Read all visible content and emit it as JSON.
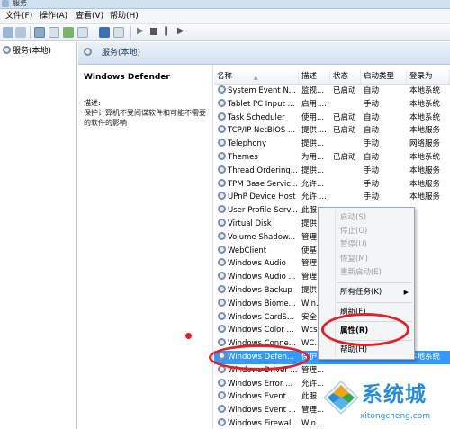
{
  "window": {
    "title": "服务"
  },
  "menu": [
    "文件(F)",
    "操作(A)",
    "查看(V)",
    "帮助(H)"
  ],
  "tree": {
    "root_label": "服务(本地)"
  },
  "header": {
    "title": "服务(本地)"
  },
  "details": {
    "service_name": "Windows Defender",
    "desc_label": "描述:",
    "desc_text": "保护计算机不受间谍软件和可能不需要的软件的影响"
  },
  "columns": [
    "名称",
    "描述",
    "状态",
    "启动类型",
    "登录为"
  ],
  "rows": [
    {
      "name": "System Event N...",
      "desc": "监视...",
      "status": "已启动",
      "start": "自动",
      "logon": "本地系统"
    },
    {
      "name": "Tablet PC Input ...",
      "desc": "启用 ...",
      "status": "",
      "start": "手动",
      "logon": "本地系统"
    },
    {
      "name": "Task Scheduler",
      "desc": "使用...",
      "status": "已启动",
      "start": "自动",
      "logon": "本地系统"
    },
    {
      "name": "TCP/IP NetBIOS ...",
      "desc": "提供 ...",
      "status": "已启动",
      "start": "自动",
      "logon": "本地服务"
    },
    {
      "name": "Telephony",
      "desc": "提供...",
      "status": "",
      "start": "手动",
      "logon": "网络服务"
    },
    {
      "name": "Themes",
      "desc": "为用...",
      "status": "已启动",
      "start": "自动",
      "logon": "本地系统"
    },
    {
      "name": "Thread Ordering...",
      "desc": "提供...",
      "status": "",
      "start": "手动",
      "logon": "本地服务"
    },
    {
      "name": "TPM Base Servic...",
      "desc": "允许...",
      "status": "",
      "start": "手动",
      "logon": "本地服务"
    },
    {
      "name": "UPnP Device Host",
      "desc": "允许 ...",
      "status": "",
      "start": "手动",
      "logon": "本地服务"
    },
    {
      "name": "User Profile Serv...",
      "desc": "此服...",
      "status": "",
      "start": "",
      "logon": ""
    },
    {
      "name": "Virtual Disk",
      "desc": "提供...",
      "status": "",
      "start": "",
      "logon": ""
    },
    {
      "name": "Volume Shadow...",
      "desc": "管理...",
      "status": "",
      "start": "",
      "logon": ""
    },
    {
      "name": "WebClient",
      "desc": "使基...",
      "status": "",
      "start": "",
      "logon": ""
    },
    {
      "name": "Windows Audio",
      "desc": "管理...",
      "status": "",
      "start": "",
      "logon": ""
    },
    {
      "name": "Windows Audio ...",
      "desc": "管理 ...",
      "status": "",
      "start": "",
      "logon": ""
    },
    {
      "name": "Windows Backup",
      "desc": "提供 ...",
      "status": "",
      "start": "",
      "logon": ""
    },
    {
      "name": "Windows Biome...",
      "desc": "Win...",
      "status": "",
      "start": "",
      "logon": ""
    },
    {
      "name": "Windows CardS...",
      "desc": "安全...",
      "status": "",
      "start": "",
      "logon": ""
    },
    {
      "name": "Windows Color ...",
      "desc": "Wcs...",
      "status": "",
      "start": "",
      "logon": ""
    },
    {
      "name": "Windows Conne...",
      "desc": "WC...",
      "status": "",
      "start": "",
      "logon": ""
    },
    {
      "name": "Windows Defen...",
      "desc": "保护...",
      "status": "",
      "start": "",
      "logon": "本地系统"
    },
    {
      "name": "Windows Driver ...",
      "desc": "管理...",
      "status": "",
      "start": "",
      "logon": ""
    },
    {
      "name": "Windows Error ...",
      "desc": "允许...",
      "status": "",
      "start": "",
      "logon": ""
    },
    {
      "name": "Windows Event ...",
      "desc": "此服...",
      "status": "",
      "start": "",
      "logon": ""
    },
    {
      "name": "Windows Event ...",
      "desc": "管理...",
      "status": "",
      "start": "",
      "logon": ""
    },
    {
      "name": "Windows Firewall",
      "desc": "Win...",
      "status": "",
      "start": "",
      "logon": ""
    }
  ],
  "context_menu": {
    "start": "启动(S)",
    "stop": "停止(O)",
    "pause": "暂停(U)",
    "resume": "恢复(M)",
    "restart": "重新启动(E)",
    "all_tasks": "所有任务(K)",
    "refresh": "刷新(F)",
    "properties": "属性(R)",
    "help": "帮助(H)"
  },
  "watermark": {
    "text": "系统城",
    "sub": "xitongcheng.com"
  },
  "colors": {
    "selection": "#3399ff",
    "annotation": "#e0212a",
    "watermark": "#2a8bd6"
  }
}
